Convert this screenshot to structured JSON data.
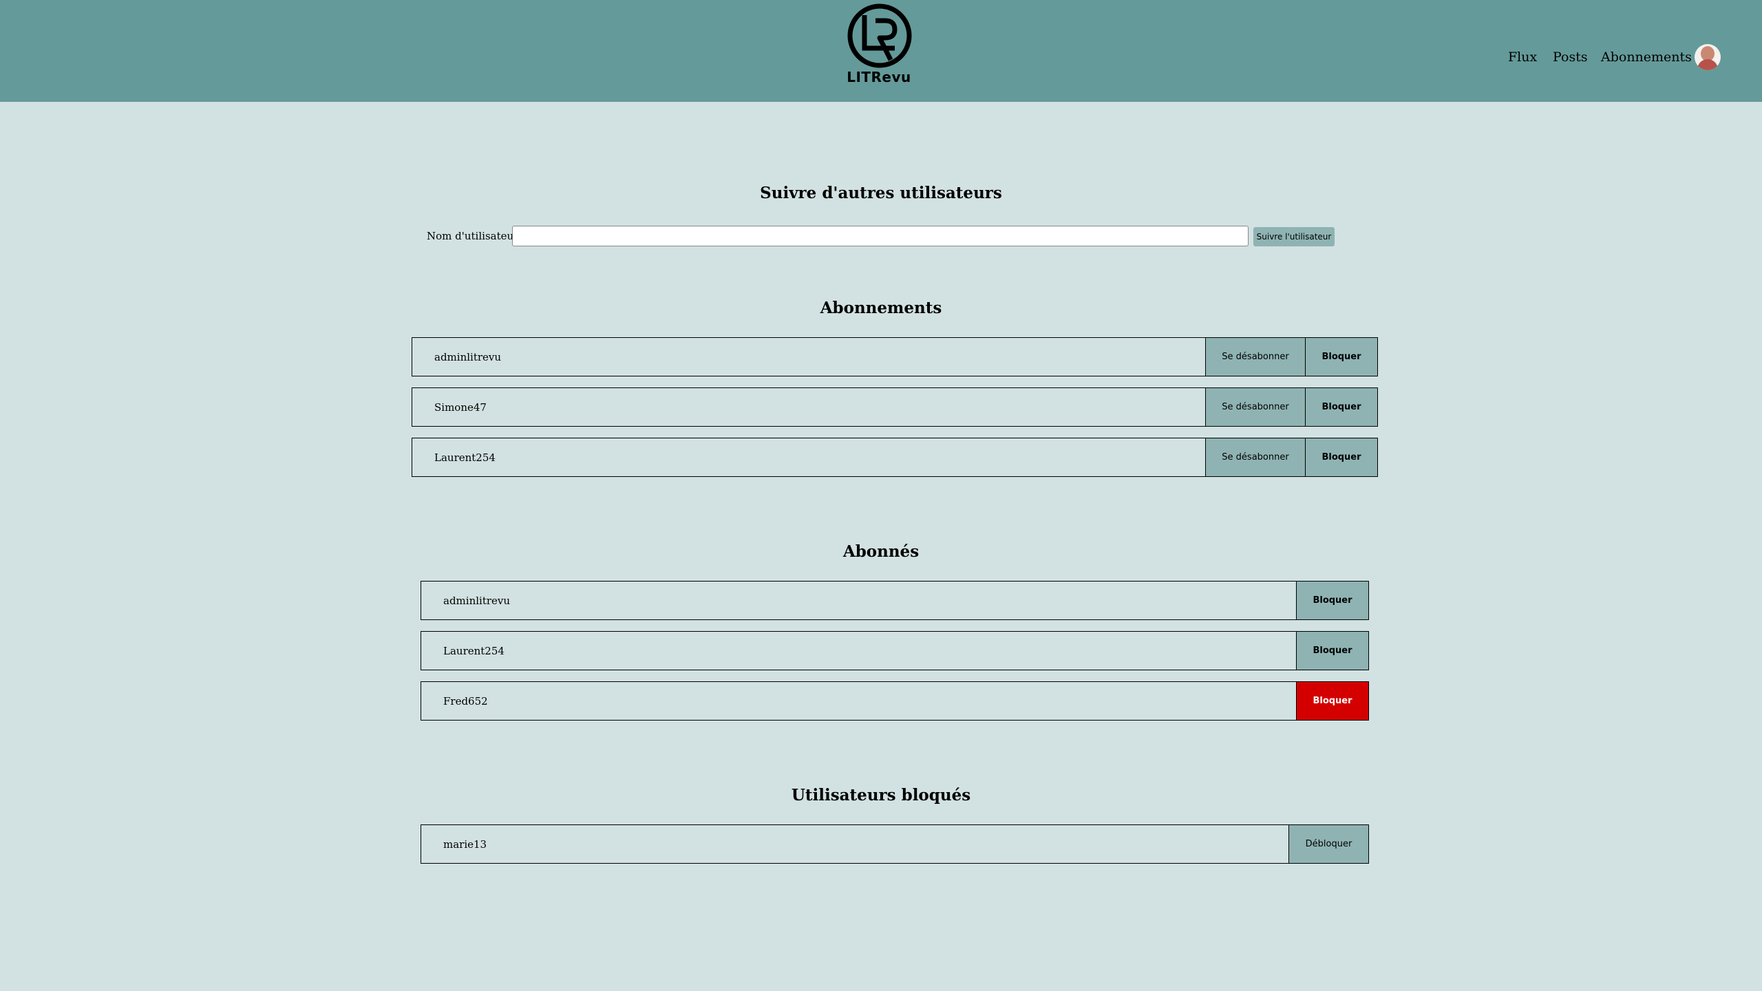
{
  "brand": {
    "name": "LITRevu"
  },
  "nav": {
    "flux": "Flux",
    "posts": "Posts",
    "abonnements": "Abonnements"
  },
  "follow": {
    "title": "Suivre d'autres utilisateurs",
    "label": "Nom d'utilisateur :",
    "value": "",
    "button": "Suivre l'utilisateur"
  },
  "abonnements": {
    "title": "Abonnements",
    "unsubscribe_label": "Se désabonner",
    "block_label": "Bloquer",
    "users": [
      "adminlitrevu",
      "Simone47",
      "Laurent254"
    ]
  },
  "abonnes": {
    "title": "Abonnés",
    "block_label": "Bloquer",
    "users": [
      "adminlitrevu",
      "Laurent254",
      "Fred652"
    ],
    "highlighted_user": "Fred652"
  },
  "bloques": {
    "title": "Utilisateurs bloqués",
    "unblock_label": "Débloquer",
    "users": [
      "marie13"
    ]
  },
  "colors": {
    "header_bg": "#659a9a",
    "page_bg": "#d2e1e1",
    "button_bg": "#8fb3b3",
    "danger": "#d40000"
  }
}
